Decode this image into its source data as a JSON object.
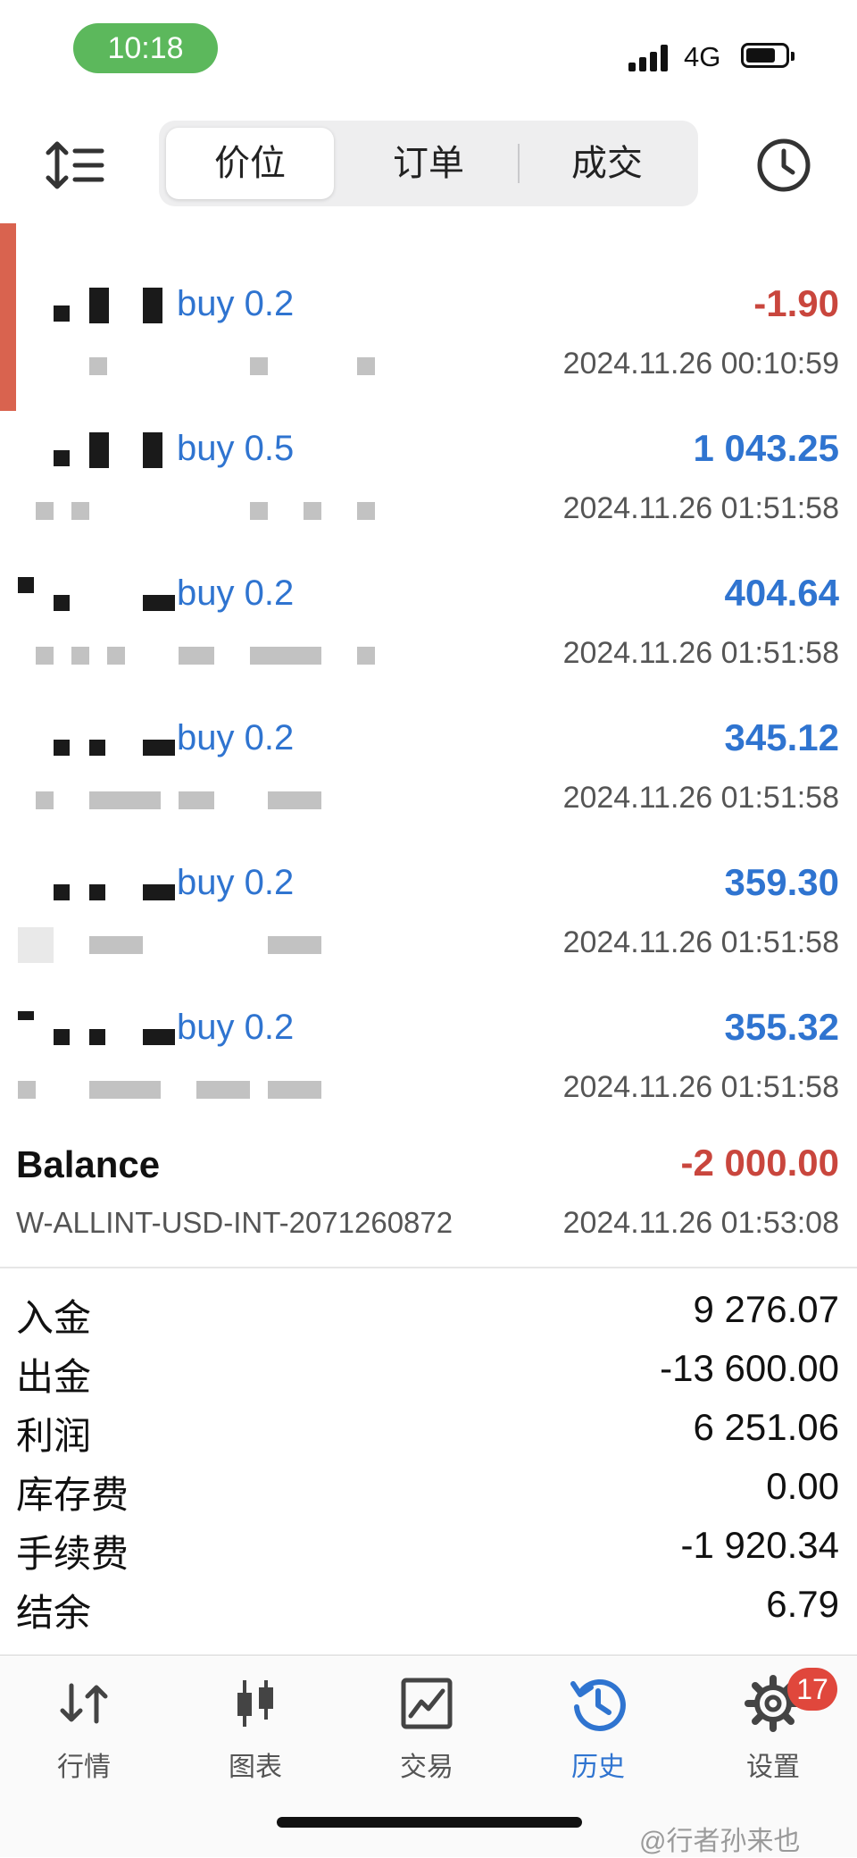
{
  "status_bar": {
    "time": "10:18",
    "network": "4G"
  },
  "header": {
    "tabs": [
      {
        "label": "价位",
        "active": true
      },
      {
        "label": "订单",
        "active": false
      },
      {
        "label": "成交",
        "active": false
      }
    ]
  },
  "deals": [
    {
      "trade": "buy 0.2",
      "profit": "-1.90",
      "time": "2024.11.26 00:10:59",
      "negative": true
    },
    {
      "trade": "buy 0.5",
      "profit": "1 043.25",
      "time": "2024.11.26 01:51:58",
      "negative": false
    },
    {
      "trade": "buy 0.2",
      "profit": "404.64",
      "time": "2024.11.26 01:51:58",
      "negative": false
    },
    {
      "trade": "buy 0.2",
      "profit": "345.12",
      "time": "2024.11.26 01:51:58",
      "negative": false
    },
    {
      "trade": "buy 0.2",
      "profit": "359.30",
      "time": "2024.11.26 01:51:58",
      "negative": false
    },
    {
      "trade": "buy 0.2",
      "profit": "355.32",
      "time": "2024.11.26 01:51:58",
      "negative": false
    }
  ],
  "balance": {
    "title": "Balance",
    "comment": "W-ALLINT-USD-INT-2071260872",
    "amount": "-2 000.00",
    "time": "2024.11.26 01:53:08"
  },
  "summary": [
    {
      "label": "入金",
      "value": "9 276.07"
    },
    {
      "label": "出金",
      "value": "-13 600.00"
    },
    {
      "label": "利润",
      "value": "6 251.06"
    },
    {
      "label": "库存费",
      "value": "0.00"
    },
    {
      "label": "手续费",
      "value": "-1 920.34"
    },
    {
      "label": "结余",
      "value": "6.79"
    }
  ],
  "nav": [
    {
      "label": "行情",
      "icon": "quotes-icon",
      "active": false
    },
    {
      "label": "图表",
      "icon": "chart-icon",
      "active": false
    },
    {
      "label": "交易",
      "icon": "trade-icon",
      "active": false
    },
    {
      "label": "历史",
      "icon": "history-icon",
      "active": true
    },
    {
      "label": "设置",
      "icon": "settings-icon",
      "active": false,
      "badge": "17"
    }
  ],
  "watermark": "@行者孙来也",
  "colors": {
    "accent": "#2f74d0",
    "negative": "#c9463d",
    "status_pill": "#5cb85c",
    "badge": "#e0473c"
  }
}
